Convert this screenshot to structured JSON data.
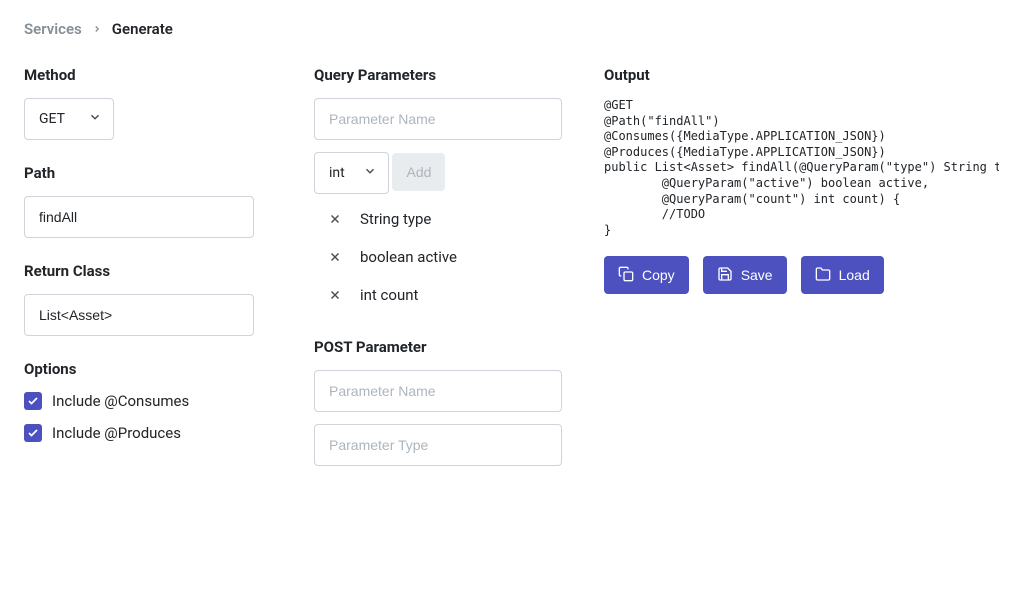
{
  "breadcrumb": {
    "parent": "Services",
    "current": "Generate"
  },
  "left": {
    "method_label": "Method",
    "method_value": "GET",
    "path_label": "Path",
    "path_value": "findAll",
    "return_label": "Return Class",
    "return_value": "List<Asset>",
    "options_label": "Options",
    "opt_consumes": "Include @Consumes",
    "opt_produces": "Include @Produces"
  },
  "mid": {
    "query_label": "Query Parameters",
    "param_name_placeholder": "Parameter Name",
    "param_type_value": "int",
    "add_label": "Add",
    "params": [
      {
        "text": "String type"
      },
      {
        "text": "boolean active"
      },
      {
        "text": "int count"
      }
    ],
    "post_label": "POST Parameter",
    "post_name_placeholder": "Parameter Name",
    "post_type_placeholder": "Parameter Type"
  },
  "right": {
    "output_label": "Output",
    "code": "@GET\n@Path(\"findAll\")\n@Consumes({MediaType.APPLICATION_JSON})\n@Produces({MediaType.APPLICATION_JSON})\npublic List<Asset> findAll(@QueryParam(\"type\") String type,\n        @QueryParam(\"active\") boolean active,\n        @QueryParam(\"count\") int count) {\n        //TODO\n}",
    "copy": "Copy",
    "save": "Save",
    "load": "Load"
  }
}
